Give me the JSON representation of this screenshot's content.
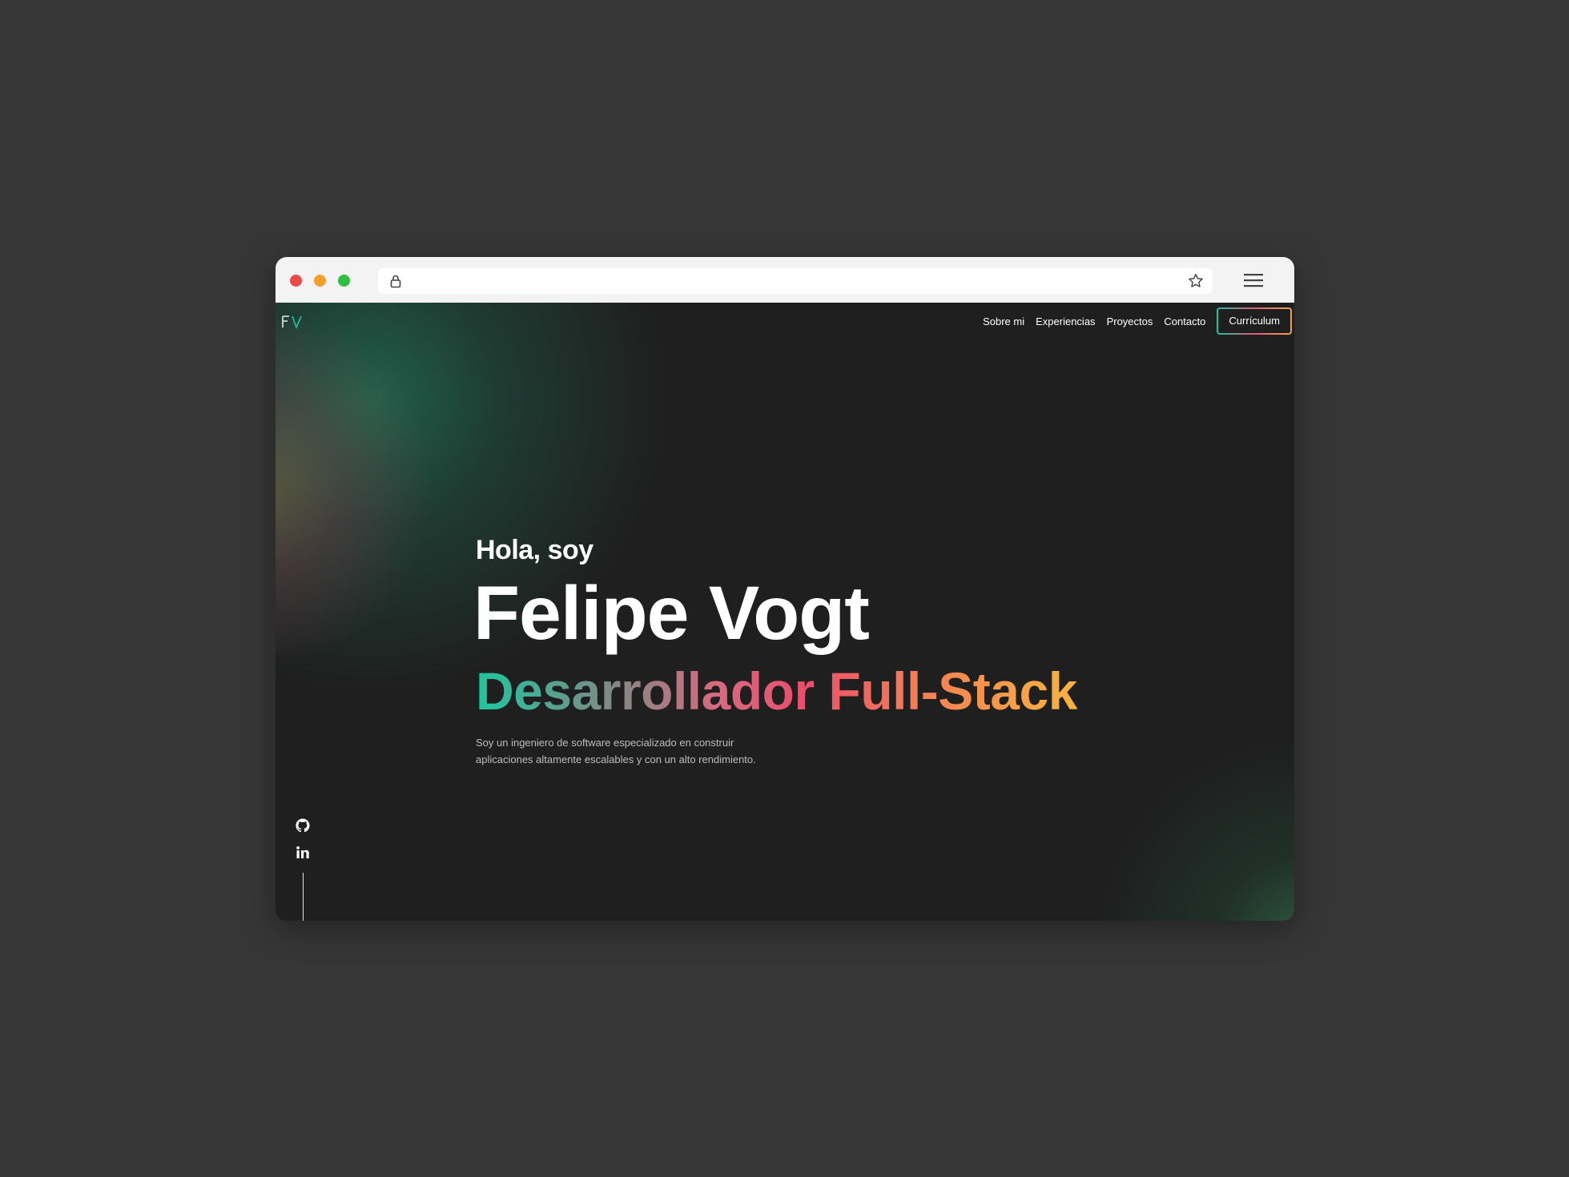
{
  "browser": {
    "lock_icon": "lock-icon",
    "bookmark_icon": "star-icon",
    "menu_icon": "hamburger-menu-icon",
    "traffic_lights": [
      "#e84b48",
      "#f0a02c",
      "#30c03f"
    ]
  },
  "site": {
    "logo": "FV",
    "nav": {
      "items": [
        "Sobre mi",
        "Experiencias",
        "Proyectos",
        "Contacto"
      ],
      "cta": "Currículum"
    },
    "hero": {
      "greeting": "Hola, soy",
      "name": "Felipe Vogt",
      "role": "Desarrollador Full-Stack",
      "description": "Soy un ingeniero de software especializado en construir aplicaciones altamente escalables y con un alto rendimiento."
    },
    "social": [
      "github-icon",
      "linkedin-icon"
    ],
    "colors": {
      "background": "#1f1f1f",
      "gradient_start": "#1ec6a0",
      "gradient_mid": "#ea4e6c",
      "gradient_end": "#f7b43e"
    }
  }
}
